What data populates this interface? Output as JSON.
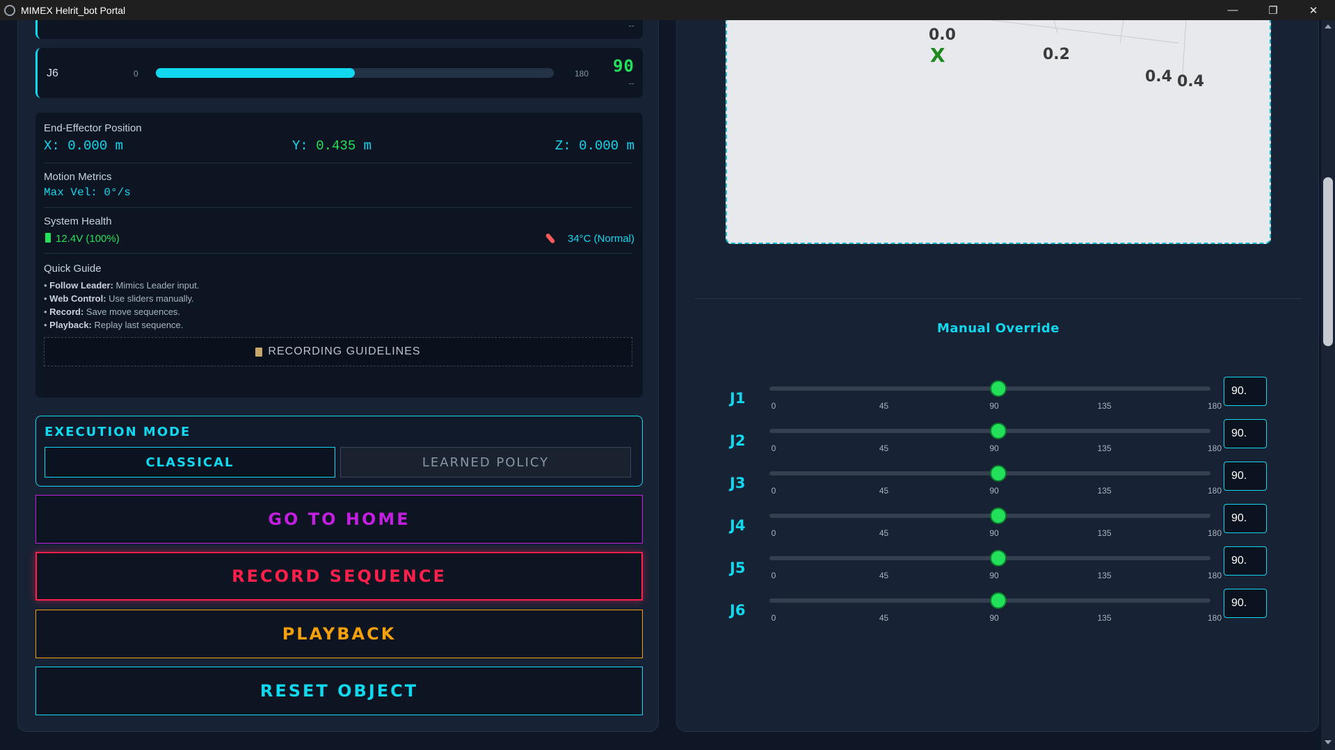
{
  "window": {
    "title": "MIMEX Helrit_bot Portal",
    "controls": {
      "minimize": "—",
      "maximize": "❐",
      "close": "✕"
    }
  },
  "joint_j6": {
    "label": "J6",
    "min": "0",
    "max": "180",
    "value": "90",
    "sub": "--",
    "fill_fraction": 0.5
  },
  "prev_joint_sub": "--",
  "end_effector": {
    "title": "End-Effector Position",
    "x": "X: 0.000 m",
    "y_label": "Y: ",
    "y_value": "0.435",
    "y_unit": " m",
    "z": "Z: 0.000 m"
  },
  "motion_metrics": {
    "title": "Motion Metrics",
    "max_vel": "Max Vel: 0°/s"
  },
  "system_health": {
    "title": "System Health",
    "battery": "12.4V (100%)",
    "temperature": "34°C (Normal)"
  },
  "quick_guide": {
    "title": "Quick Guide",
    "items": [
      {
        "term": "Follow Leader:",
        "text": " Mimics Leader input."
      },
      {
        "term": "Web Control:",
        "text": " Use sliders manually."
      },
      {
        "term": "Record:",
        "text": " Save move sequences."
      },
      {
        "term": "Playback:",
        "text": " Replay last sequence."
      }
    ],
    "bullet": "• ",
    "guidelines_button": "RECORDING GUIDELINES"
  },
  "execution_mode": {
    "title": "EXECUTION MODE",
    "classical": "CLASSICAL",
    "learned": "LEARNED POLICY"
  },
  "actions": {
    "go_home": "GO TO HOME",
    "record": "RECORD SEQUENCE",
    "playback": "PLAYBACK",
    "reset": "RESET OBJECT"
  },
  "plot": {
    "labels": {
      "a": "0.0",
      "x_axis": "X",
      "b": "0.2",
      "c": "0.4",
      "d": "0.4"
    }
  },
  "manual_override": {
    "title": "Manual Override",
    "ticks": [
      "0",
      "45",
      "90",
      "135",
      "180"
    ],
    "range": [
      0,
      180
    ],
    "joints": [
      {
        "label": "J1",
        "value": 90,
        "input": "90."
      },
      {
        "label": "J2",
        "value": 90,
        "input": "90."
      },
      {
        "label": "J3",
        "value": 90,
        "input": "90."
      },
      {
        "label": "J4",
        "value": 90,
        "input": "90."
      },
      {
        "label": "J5",
        "value": 90,
        "input": "90."
      },
      {
        "label": "J6",
        "value": 90,
        "input": "90."
      }
    ]
  },
  "colors": {
    "accent": "#11d8ee",
    "ok": "#22e05a",
    "home": "#c21fe0",
    "record": "#ff1f4b",
    "playback": "#f5a00a"
  }
}
